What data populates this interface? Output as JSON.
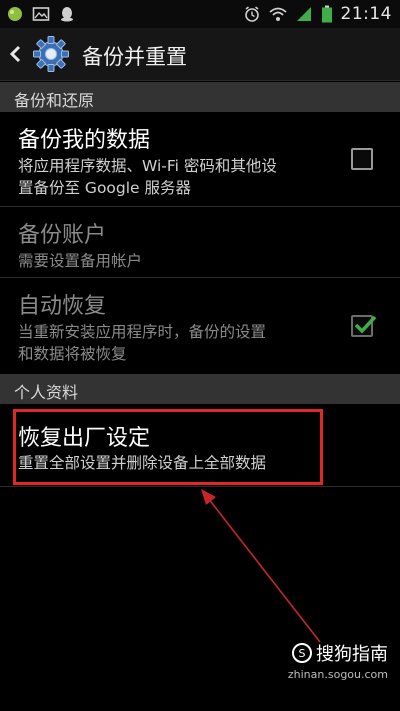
{
  "status_bar": {
    "time": "21:14",
    "left_icons": [
      "notification-icon",
      "gallery-icon",
      "qq-icon"
    ],
    "right_icons": [
      "alarm-icon",
      "wifi-icon",
      "signal-icon",
      "battery-icon"
    ]
  },
  "action_bar": {
    "title": "备份并重置",
    "back_icon": "chevron-left-icon",
    "app_icon": "gear-icon"
  },
  "sections": [
    {
      "header": "备份和还原",
      "items": [
        {
          "title": "备份我的数据",
          "summary_lines": [
            "将应用程序数据、Wi-Fi 密码和其他设",
            "置备份至 Google 服务器"
          ],
          "checkbox": "unchecked",
          "enabled": true
        },
        {
          "title": "备份账户",
          "summary_lines": [
            "需要设置备用帐户"
          ],
          "enabled": false
        },
        {
          "title": "自动恢复",
          "summary_lines": [
            "当重新安装应用程序时，备份的设置",
            "和数据将被恢复"
          ],
          "checkbox": "checked",
          "enabled": false
        }
      ]
    },
    {
      "header": "个人资料",
      "items": [
        {
          "title": "恢复出厂设定",
          "summary_lines": [
            "重置全部设置并删除设备上全部数据"
          ],
          "enabled": true
        }
      ]
    }
  ],
  "annotation": {
    "highlight_color": "#e2262a"
  },
  "watermark": {
    "logo_text": "搜狗指南",
    "url": "zhinan.sogou.com"
  },
  "colors": {
    "background": "#000000",
    "section_header": "#333333",
    "disabled_text": "#8a8a8a",
    "checkmark": "#3fae49"
  }
}
